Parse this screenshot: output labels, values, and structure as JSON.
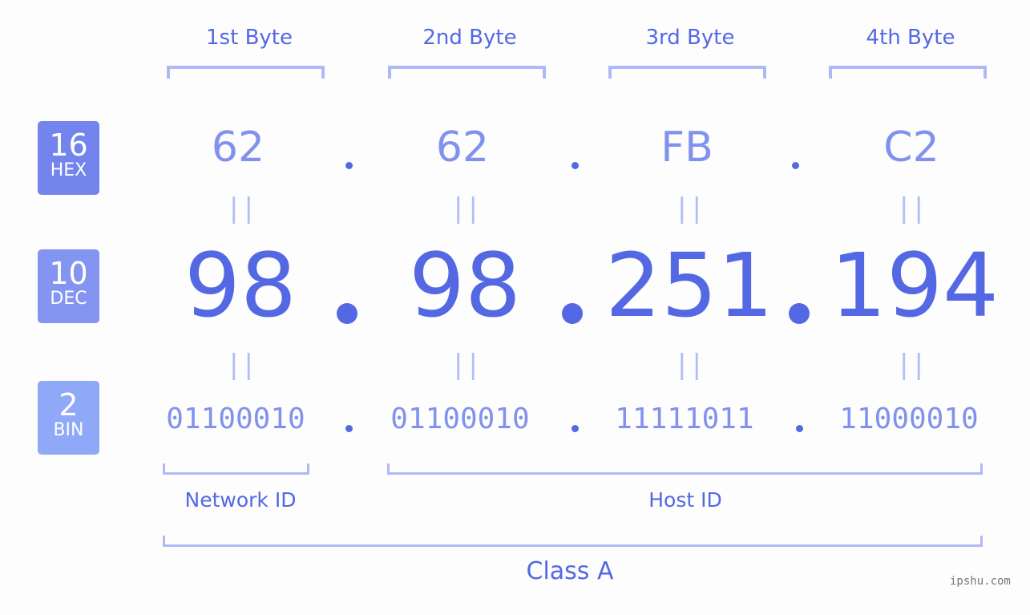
{
  "bytes": [
    {
      "label": "1st Byte",
      "hex": "62",
      "dec": "98",
      "bin": "01100010"
    },
    {
      "label": "2nd Byte",
      "hex": "62",
      "dec": "98",
      "bin": "01100010"
    },
    {
      "label": "3rd Byte",
      "hex": "FB",
      "dec": "251",
      "bin": "11111011"
    },
    {
      "label": "4th Byte",
      "hex": "C2",
      "dec": "194",
      "bin": "11000010"
    }
  ],
  "badges": {
    "hex": {
      "num": "16",
      "label": "HEX",
      "color": "#7385ec"
    },
    "dec": {
      "num": "10",
      "label": "DEC",
      "color": "#8495f1"
    },
    "bin": {
      "num": "2",
      "label": "BIN",
      "color": "#90a8f8"
    }
  },
  "equals_symbol": "||",
  "segments": {
    "network": "Network ID",
    "host": "Host ID",
    "class": "Class A"
  },
  "watermark": "ipshu.com"
}
